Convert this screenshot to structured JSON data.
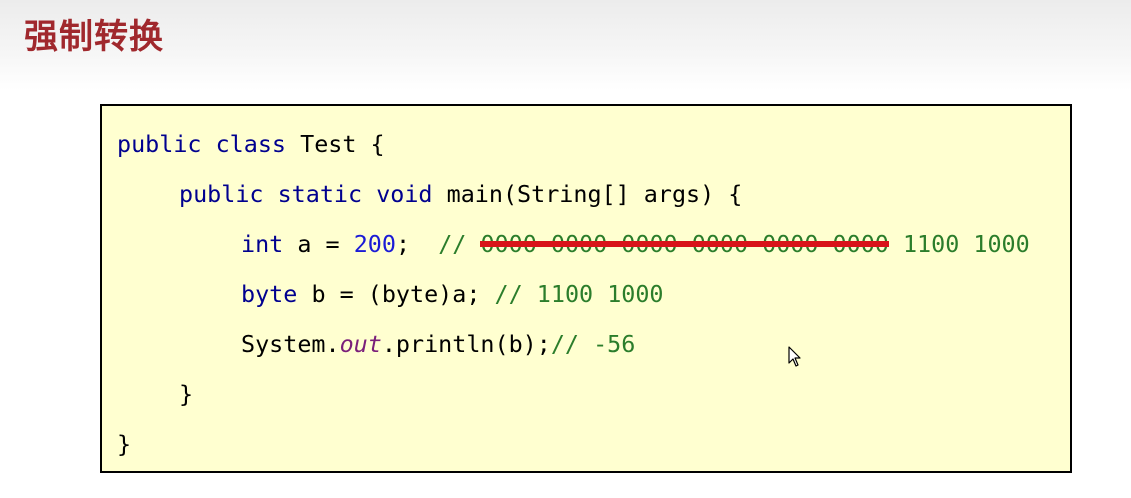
{
  "slide": {
    "title": "强制转换"
  },
  "code": {
    "line1": {
      "kw_public": "public",
      "kw_class": "class",
      "class_name": "Test",
      "brace_open": "{"
    },
    "line2": {
      "kw_public": "public",
      "kw_static": "static",
      "kw_void": "void",
      "signature": "main(String[] args)",
      "brace_open": "{"
    },
    "line3": {
      "kw_int": "int",
      "decl": "a =",
      "value": "200",
      "semicolon": ";",
      "comment_prefix": "//",
      "struck_bits": "0000 0000 0000 0000 0000 0000",
      "low_bits": "1100 1000"
    },
    "line4": {
      "kw_byte": "byte",
      "decl": "b = (byte)a;",
      "comment": "// 1100 1000"
    },
    "line5": {
      "system": "System.",
      "out": "out",
      "call": ".println(b);",
      "comment": "// -56"
    },
    "line6": {
      "brace_close": "}"
    },
    "line7": {
      "brace_close": "}"
    }
  },
  "colors": {
    "title": "#a0282d",
    "code_background": "#ffffd0",
    "keyword": "#00008f",
    "number": "#1b1bd6",
    "comment": "#2b7d2b",
    "field_italic": "#7a1f7a",
    "strike": "#d8141a"
  },
  "icons": {
    "cursor": "mouse-pointer-icon"
  }
}
